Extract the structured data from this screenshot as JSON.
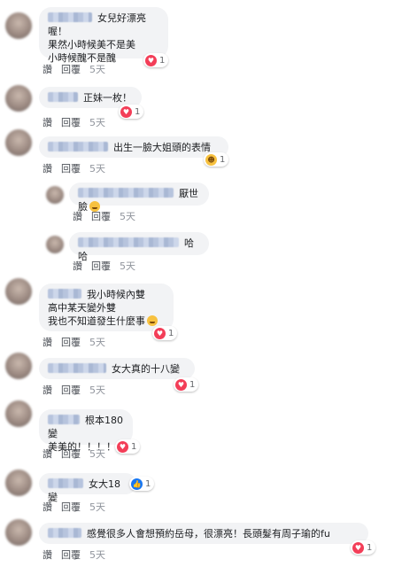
{
  "comments": [
    {
      "lines": "女兒好漂亮喔！\n果然小時候美不是美\n小時候醜不是醜",
      "reaction": "heart",
      "count": "1",
      "time": "5天"
    },
    {
      "lines": "正妹一枚！",
      "reaction": "heart",
      "count": "1",
      "time": "5天"
    },
    {
      "lines": "出生一臉大姐頭的表情",
      "reaction": "laugh",
      "count": "1",
      "time": "5天"
    },
    {
      "lines": "厭世臉",
      "emoji": "🤣",
      "time": "5天"
    },
    {
      "lines": "哈哈",
      "time": "5天"
    },
    {
      "lines": "我小時候內雙\n高中某天變外雙\n我也不知道發生什麼事",
      "emoji": "😊",
      "reaction": "heart",
      "count": "1",
      "time": "5天"
    },
    {
      "lines": "女大真的十八變",
      "reaction": "heart",
      "count": "1",
      "time": "5天"
    },
    {
      "lines": "根本180變\n美美的！！！！",
      "reaction": "heart",
      "count": "1",
      "time": "5天"
    },
    {
      "lines": "女大18變",
      "reaction": "like",
      "count": "1",
      "time": "5天"
    },
    {
      "lines": "感覺很多人會想預約岳母，很漂亮！長頭髮有周子瑜的fu",
      "reaction": "heart",
      "count": "1",
      "time": "5天"
    }
  ],
  "labels": {
    "like": "讚",
    "reply": "回覆"
  },
  "colors": {
    "heart": "#f33e58",
    "like": "#1877f2",
    "laugh": "#f7c13f",
    "bubble": "#f2f3f5"
  },
  "icons": {
    "heart": "heart-icon",
    "like": "thumbs-up-icon",
    "laugh": "laughing-emoji-icon"
  }
}
